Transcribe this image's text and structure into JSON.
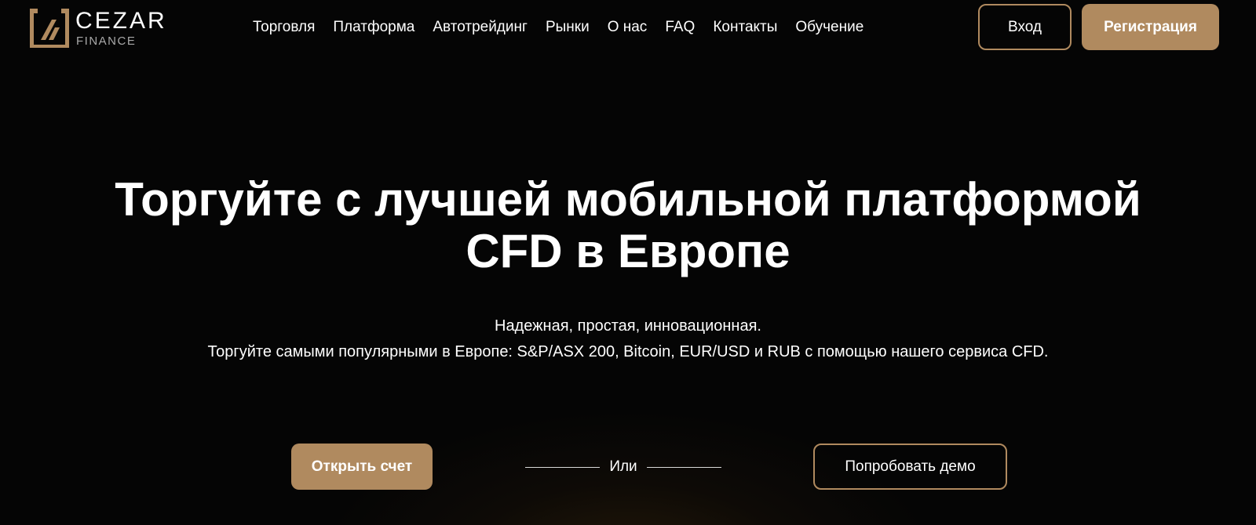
{
  "brand": {
    "name": "CEZAR",
    "sub": "FINANCE",
    "accent_color": "#b08a5f"
  },
  "nav": {
    "items": [
      {
        "label": "Торговля"
      },
      {
        "label": "Платформа"
      },
      {
        "label": "Автотрейдинг"
      },
      {
        "label": "Рынки"
      },
      {
        "label": "О нас"
      },
      {
        "label": "FAQ"
      },
      {
        "label": "Контакты"
      },
      {
        "label": "Обучение"
      }
    ]
  },
  "auth": {
    "login_label": "Вход",
    "register_label": "Регистрация"
  },
  "hero": {
    "title": "Торгуйте с лучшей мобильной платформой CFD в Европе",
    "subtitle_line1": "Надежная, простая, инновационная.",
    "subtitle_line2": "Торгуйте самыми популярными в Европе: S&P/ASX 200, Bitcoin, EUR/USD и RUB с помощью нашего сервиса CFD."
  },
  "cta": {
    "open_account_label": "Открыть счет",
    "or_label": "Или",
    "demo_label": "Попробовать демо"
  }
}
